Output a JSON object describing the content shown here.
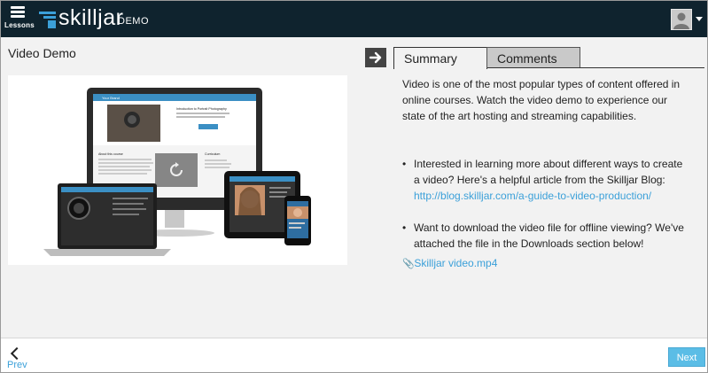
{
  "header": {
    "lessons_label": "Lessons",
    "brand": "skilljar",
    "brand_suffix": "DEMO",
    "colors": {
      "bar": "#0f232e",
      "accent": "#3ba0d9"
    }
  },
  "lesson": {
    "title": "Video Demo"
  },
  "video_thumb": {
    "screen_brand": "Your Brand",
    "screen_heading": "Introduction to Portrait Photography",
    "about_label": "About this course",
    "curriculum_label": "Curriculum"
  },
  "tabs": [
    {
      "label": "Summary",
      "active": true
    },
    {
      "label": "Comments",
      "active": false
    }
  ],
  "summary": {
    "intro": "Video is one of the most popular types of content offered in online courses. Watch the video demo to experience our state of the art hosting and streaming capabilities.",
    "bullet1_text": "Interested in learning more about different ways to create a video? Here's a helpful article from the Skilljar Blog: ",
    "bullet1_link": "http://blog.skilljar.com/a-guide-to-video-production/",
    "bullet2_text": "Want to download the video file for offline viewing? We've attached the file in the Downloads section below!",
    "attachment": "Skilljar video.mp4"
  },
  "footer": {
    "prev_label": "Prev",
    "next_label": "Next"
  }
}
